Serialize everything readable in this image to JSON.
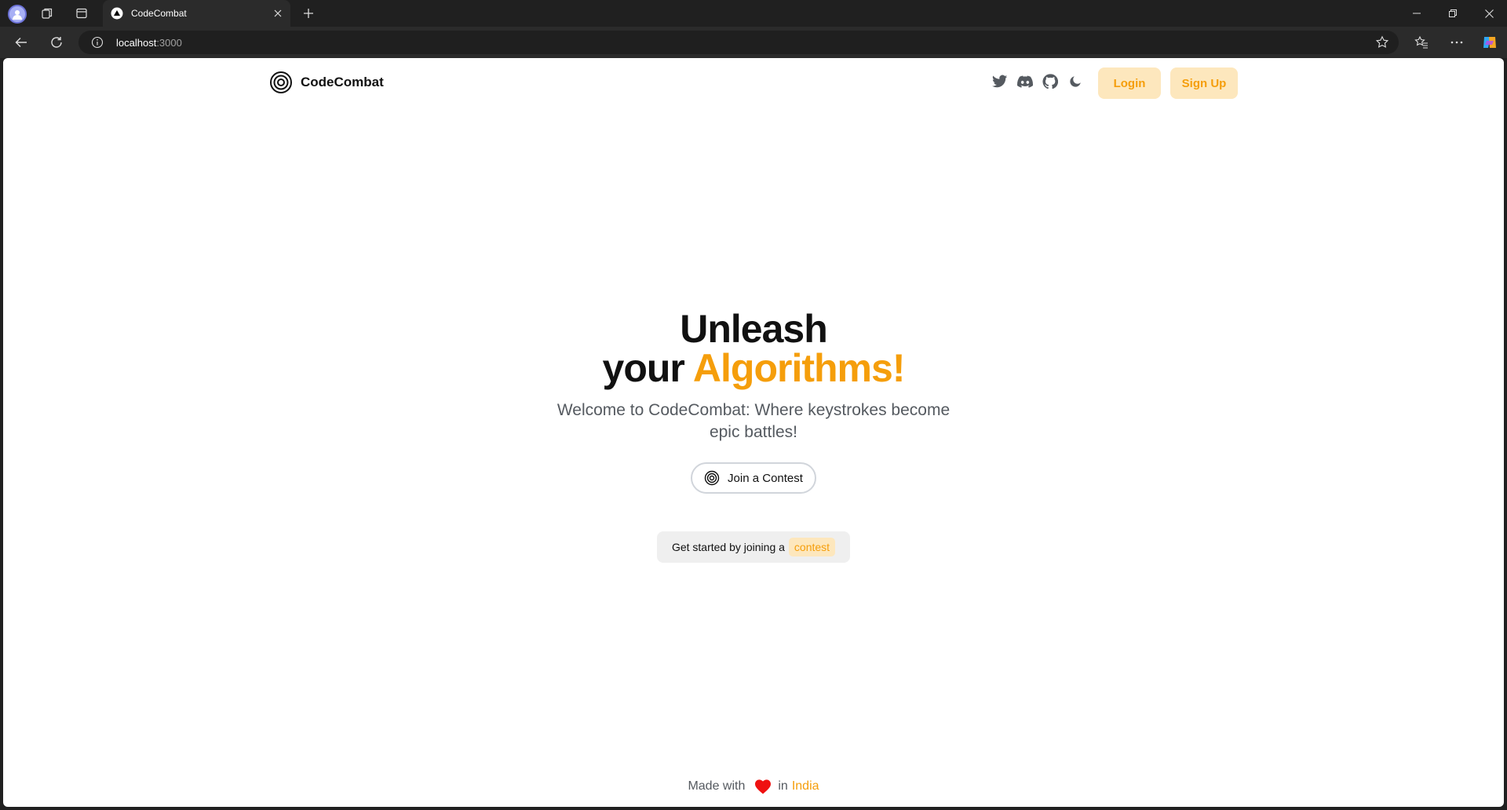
{
  "browser": {
    "tab_title": "CodeCombat",
    "url_host": "localhost",
    "url_port": ":3000"
  },
  "header": {
    "brand": "CodeCombat",
    "login_label": "Login",
    "signup_label": "Sign Up",
    "icons": [
      "twitter-icon",
      "discord-icon",
      "github-icon",
      "moon-icon"
    ]
  },
  "hero": {
    "title_line1": "Unleash",
    "title_line2_prefix": "your",
    "title_line2_accent": "Algorithms!",
    "subtitle": "Welcome to CodeCombat: Where keystrokes become epic battles!",
    "join_label": "Join a Contest"
  },
  "started": {
    "text": "Get started by joining a",
    "code": "contest"
  },
  "footer": {
    "made_with": "Made with",
    "in": "in",
    "country": "India"
  },
  "colors": {
    "accent": "#f59e0b",
    "accent_bg": "#fde7bd",
    "heart": "#ef1111"
  }
}
